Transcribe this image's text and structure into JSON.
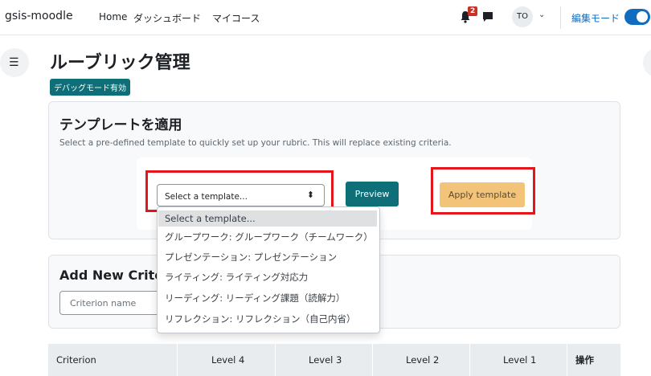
{
  "navbar": {
    "brand": "gsis-moodle",
    "links": [
      "Home",
      "ダッシュボード",
      "マイコース"
    ],
    "notification_count": "2",
    "user_initials": "TO",
    "edit_mode_label": "編集モード"
  },
  "page": {
    "title": "ルーブリック管理",
    "debug_badge": "デバッグモード有効"
  },
  "template_section": {
    "title": "テンプレートを適用",
    "description": "Select a pre-defined template to quickly set up your rubric. This will replace existing criteria.",
    "select_value": "Select a template...",
    "preview_label": "Preview",
    "apply_label": "Apply template",
    "options": [
      "Select a template...",
      "グループワーク: グループワーク（チームワーク）",
      "プレゼンテーション: プレゼンテーション",
      "ライティング: ライティング対応力",
      "リーディング: リーディング課題（読解力）",
      "リフレクション: リフレクション（自己内省）"
    ]
  },
  "add_criterion": {
    "title": "Add New Criterion",
    "input_placeholder": "Criterion name"
  },
  "table": {
    "headers": [
      "Criterion",
      "Level 4",
      "Level 3",
      "Level 2",
      "Level 1",
      "操作"
    ]
  },
  "colors": {
    "primary": "#0f6cbf",
    "teal": "#0f6f78",
    "apply_button": "#f3c37a",
    "highlight_red": "#e3161b"
  }
}
